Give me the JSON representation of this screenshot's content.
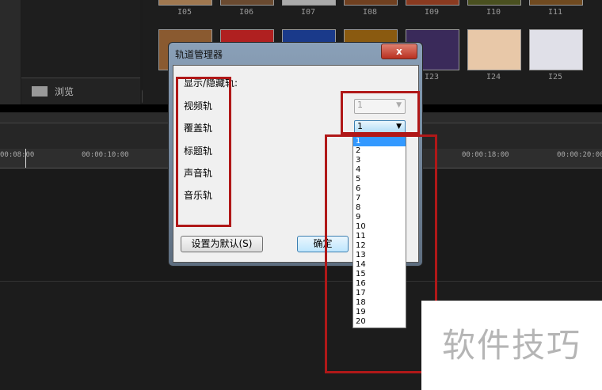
{
  "library": {
    "row1": [
      "I05",
      "I06",
      "I07",
      "I08",
      "I09",
      "I10",
      "I11"
    ],
    "row2": [
      "I23",
      "I24",
      "I25"
    ]
  },
  "browse_label": "浏览",
  "collapse_icon": "«",
  "timeline": {
    "ticks": [
      "00:08:00",
      "00:00:10:00",
      "00:00:18:00",
      "00:00:20:00"
    ]
  },
  "dialog": {
    "title": "轨道管理器",
    "close": "x",
    "heading": "显示/隐藏轨:",
    "tracks": [
      "视频轨",
      "覆盖轨",
      "标题轨",
      "声音轨",
      "音乐轨"
    ],
    "video_value": "1",
    "overlay_value": "1",
    "options": [
      "1",
      "2",
      "3",
      "4",
      "5",
      "6",
      "7",
      "8",
      "9",
      "10",
      "11",
      "12",
      "13",
      "14",
      "15",
      "16",
      "17",
      "18",
      "19",
      "20"
    ],
    "default_button": "设置为默认(S)",
    "ok_button": "确定"
  },
  "watermark": "软件技巧"
}
